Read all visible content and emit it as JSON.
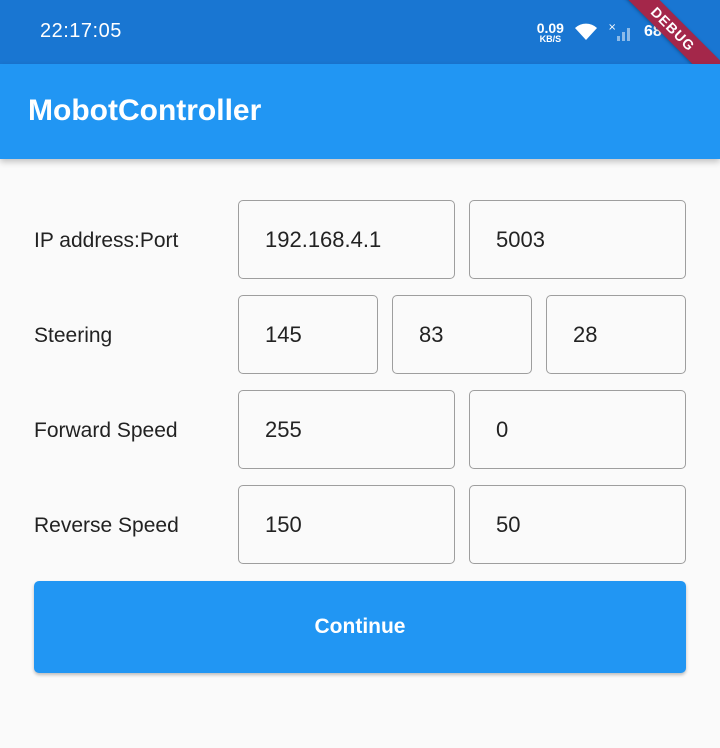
{
  "status_bar": {
    "time": "22:17:05",
    "net_speed": "0.09",
    "net_speed_unit": "KB/S",
    "battery": "68%",
    "debug_banner": "DEBUG"
  },
  "app_bar": {
    "title": "MobotController"
  },
  "form": {
    "ip": {
      "label": "IP address:Port",
      "address": "192.168.4.1",
      "port": "5003"
    },
    "steering": {
      "label": "Steering",
      "values": [
        "145",
        "83",
        "28"
      ]
    },
    "forward": {
      "label": "Forward Speed",
      "values": [
        "255",
        "0"
      ]
    },
    "reverse": {
      "label": "Reverse Speed",
      "values": [
        "150",
        "50"
      ]
    }
  },
  "continue_label": "Continue",
  "colors": {
    "status_bar": "#1976d2",
    "app_bar": "#2196f3",
    "button": "#2196f3",
    "ribbon": "#a4274a"
  }
}
